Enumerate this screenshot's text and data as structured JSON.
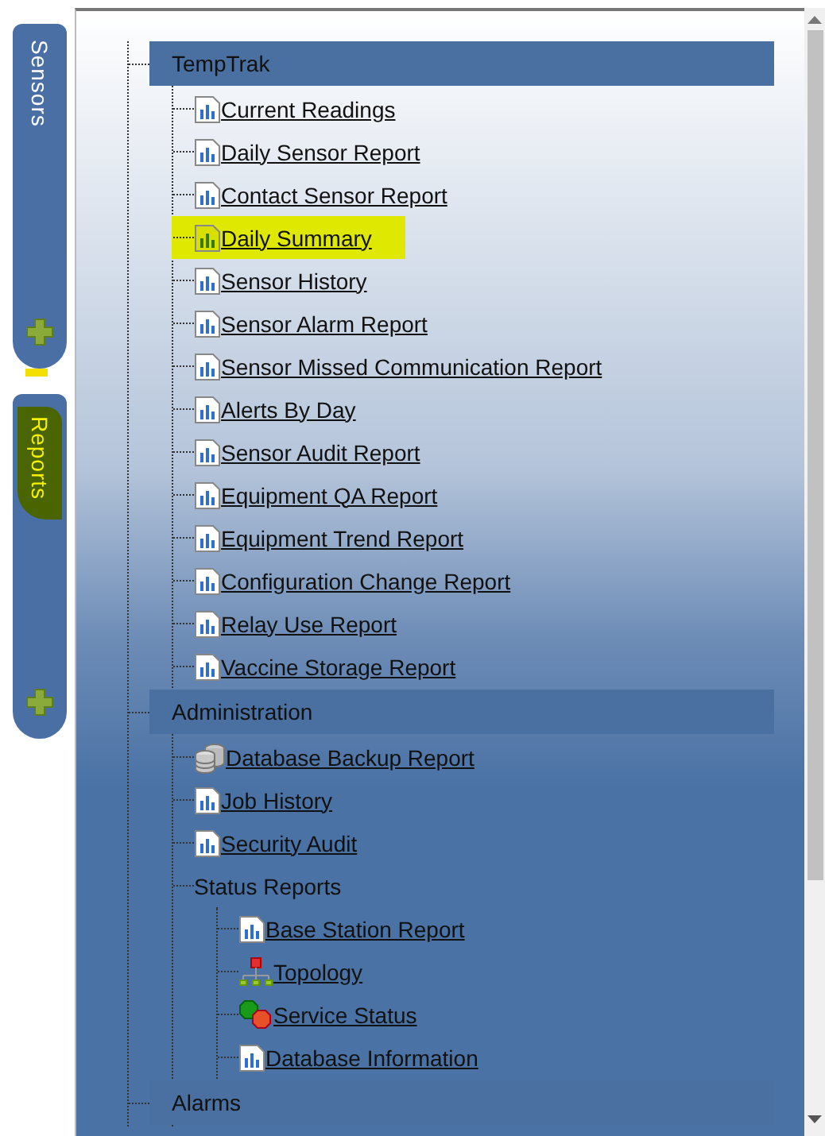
{
  "tabs": [
    {
      "label": "Sensors",
      "selected": false
    },
    {
      "label": "Reports",
      "selected": true
    }
  ],
  "tree": [
    {
      "label": "TempTrak",
      "children": [
        {
          "label": "Current Readings",
          "kind": "report",
          "highlighted": false
        },
        {
          "label": "Daily Sensor Report",
          "kind": "report",
          "highlighted": false
        },
        {
          "label": "Contact Sensor Report",
          "kind": "report",
          "highlighted": false
        },
        {
          "label": "Daily Summary",
          "kind": "report",
          "highlighted": true
        },
        {
          "label": "Sensor History",
          "kind": "report",
          "highlighted": false
        },
        {
          "label": "Sensor Alarm Report",
          "kind": "report",
          "highlighted": false
        },
        {
          "label": "Sensor Missed Communication Report",
          "kind": "report",
          "highlighted": false
        },
        {
          "label": "Alerts By Day",
          "kind": "report",
          "highlighted": false
        },
        {
          "label": "Sensor Audit Report",
          "kind": "report",
          "highlighted": false
        },
        {
          "label": "Equipment QA Report",
          "kind": "report",
          "highlighted": false
        },
        {
          "label": "Equipment Trend Report",
          "kind": "report",
          "highlighted": false
        },
        {
          "label": "Configuration Change Report",
          "kind": "report",
          "highlighted": false
        },
        {
          "label": "Relay Use Report",
          "kind": "report",
          "highlighted": false
        },
        {
          "label": "Vaccine Storage Report",
          "kind": "report",
          "highlighted": false
        }
      ]
    },
    {
      "label": "Administration",
      "children": [
        {
          "label": "Database Backup Report",
          "kind": "database",
          "highlighted": false
        },
        {
          "label": "Job History",
          "kind": "report",
          "highlighted": false
        },
        {
          "label": "Security Audit",
          "kind": "report",
          "highlighted": false
        },
        {
          "label": "Status Reports",
          "kind": "group",
          "highlighted": false,
          "children": [
            {
              "label": "Base Station Report",
              "kind": "report",
              "highlighted": false
            },
            {
              "label": "Topology",
              "kind": "topology",
              "highlighted": false
            },
            {
              "label": "Service Status",
              "kind": "service",
              "highlighted": false
            },
            {
              "label": "Database Information",
              "kind": "report",
              "highlighted": false
            }
          ]
        }
      ]
    },
    {
      "label": "Alarms"
    }
  ]
}
